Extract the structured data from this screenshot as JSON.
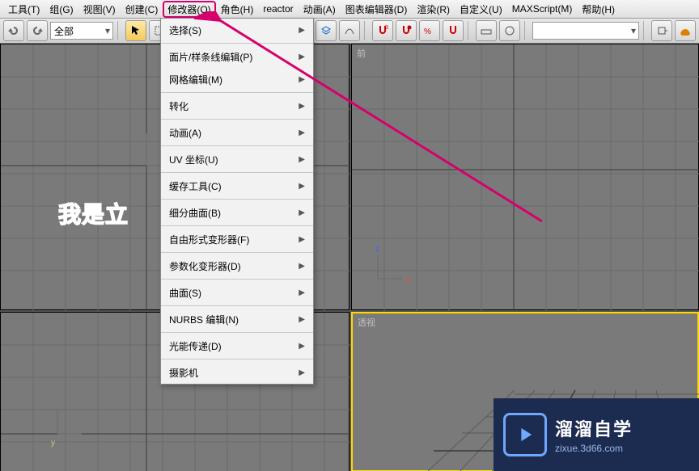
{
  "menubar": {
    "items": [
      {
        "label": "工具(T)"
      },
      {
        "label": "组(G)"
      },
      {
        "label": "视图(V)"
      },
      {
        "label": "创建(C)"
      },
      {
        "label": "修改器(O)",
        "highlighted": true
      },
      {
        "label": "角色(H)"
      },
      {
        "label": "reactor"
      },
      {
        "label": "动画(A)"
      },
      {
        "label": "图表编辑器(D)"
      },
      {
        "label": "渲染(R)"
      },
      {
        "label": "自定义(U)"
      },
      {
        "label": "MAXScript(M)"
      },
      {
        "label": "帮助(H)"
      }
    ]
  },
  "toolbar": {
    "filter_label": "全部",
    "right_dropdown_label": ""
  },
  "dropdown": {
    "items": [
      {
        "label": "选择(S)",
        "sub": true
      },
      {
        "sep": true
      },
      {
        "label": "面片/样条线编辑(P)",
        "sub": true
      },
      {
        "label": "网格编辑(M)",
        "sub": true
      },
      {
        "sep": true
      },
      {
        "label": "转化",
        "sub": true
      },
      {
        "sep": true
      },
      {
        "label": "动画(A)",
        "sub": true
      },
      {
        "sep": true
      },
      {
        "label": "UV 坐标(U)",
        "sub": true
      },
      {
        "sep": true
      },
      {
        "label": "缓存工具(C)",
        "sub": true
      },
      {
        "sep": true
      },
      {
        "label": "细分曲面(B)",
        "sub": true
      },
      {
        "sep": true
      },
      {
        "label": "自由形式变形器(F)",
        "sub": true
      },
      {
        "sep": true
      },
      {
        "label": "参数化变形器(D)",
        "sub": true
      },
      {
        "sep": true
      },
      {
        "label": "曲面(S)",
        "sub": true
      },
      {
        "sep": true
      },
      {
        "label": "NURBS 编辑(N)",
        "sub": true
      },
      {
        "sep": true
      },
      {
        "label": "光能传递(D)",
        "sub": true
      },
      {
        "sep": true
      },
      {
        "label": "摄影机",
        "sub": true
      }
    ]
  },
  "viewports": {
    "front_label": "前",
    "perspective_label": "透视",
    "axis": {
      "x": "x",
      "y": "y",
      "z": "z"
    }
  },
  "overlay_text": "我是立",
  "badge": {
    "title": "溜溜自学",
    "sub": "zixue.3d66.com"
  }
}
